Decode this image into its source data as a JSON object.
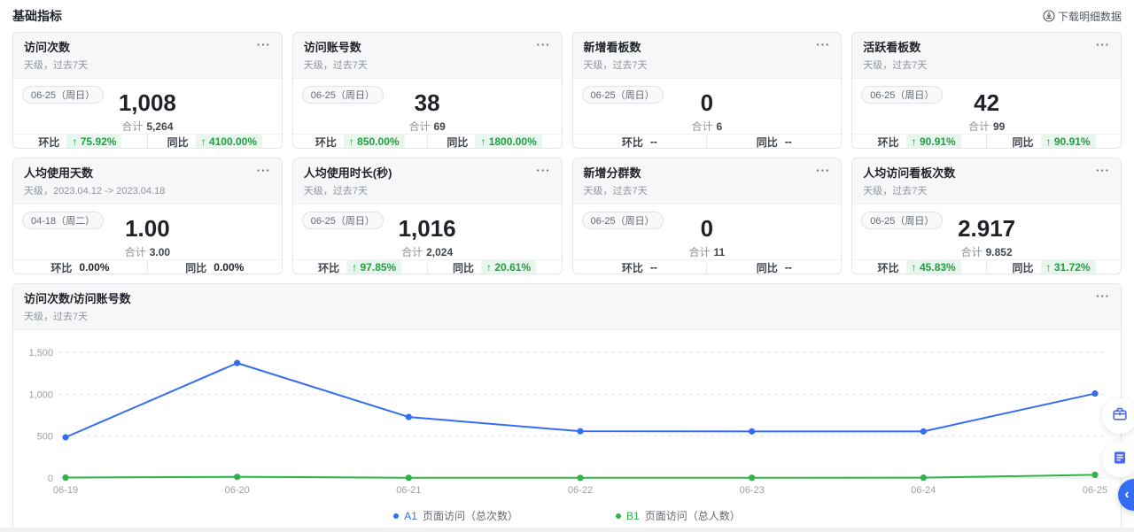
{
  "page": {
    "title": "基础指标",
    "download_label": "下载明细数据",
    "more_label": "···"
  },
  "cards": [
    {
      "title": "访问次数",
      "subtitle": "天级，过去7天",
      "date_badge": "06-25（周日）",
      "value": "1,008",
      "total_label": "合计",
      "total": "5,264",
      "mom_label": "环比",
      "mom": "↑ 75.92%",
      "mom_style": "up",
      "yoy_label": "同比",
      "yoy": "↑ 4100.00%",
      "yoy_style": "up"
    },
    {
      "title": "访问账号数",
      "subtitle": "天级，过去7天",
      "date_badge": "06-25（周日）",
      "value": "38",
      "total_label": "合计",
      "total": "69",
      "mom_label": "环比",
      "mom": "↑ 850.00%",
      "mom_style": "up",
      "yoy_label": "同比",
      "yoy": "↑ 1800.00%",
      "yoy_style": "up"
    },
    {
      "title": "新增看板数",
      "subtitle": "天级，过去7天",
      "date_badge": "06-25（周日）",
      "value": "0",
      "total_label": "合计",
      "total": "6",
      "mom_label": "环比",
      "mom": "--",
      "mom_style": "flat",
      "yoy_label": "同比",
      "yoy": "--",
      "yoy_style": "flat"
    },
    {
      "title": "活跃看板数",
      "subtitle": "天级，过去7天",
      "date_badge": "06-25（周日）",
      "value": "42",
      "total_label": "合计",
      "total": "99",
      "mom_label": "环比",
      "mom": "↑ 90.91%",
      "mom_style": "up",
      "yoy_label": "同比",
      "yoy": "↑ 90.91%",
      "yoy_style": "up"
    },
    {
      "title": "人均使用天数",
      "subtitle": "天级，2023.04.12 -> 2023.04.18",
      "date_badge": "04-18（周二）",
      "value": "1.00",
      "total_label": "合计",
      "total": "3.00",
      "mom_label": "环比",
      "mom": "0.00%",
      "mom_style": "flat",
      "yoy_label": "同比",
      "yoy": "0.00%",
      "yoy_style": "flat"
    },
    {
      "title": "人均使用时长(秒)",
      "subtitle": "天级，过去7天",
      "date_badge": "06-25（周日）",
      "value": "1,016",
      "total_label": "合计",
      "total": "2,024",
      "mom_label": "环比",
      "mom": "↑ 97.85%",
      "mom_style": "up",
      "yoy_label": "同比",
      "yoy": "↑ 20.61%",
      "yoy_style": "up"
    },
    {
      "title": "新增分群数",
      "subtitle": "天级，过去7天",
      "date_badge": "06-25（周日）",
      "value": "0",
      "total_label": "合计",
      "total": "11",
      "mom_label": "环比",
      "mom": "--",
      "mom_style": "flat",
      "yoy_label": "同比",
      "yoy": "--",
      "yoy_style": "flat"
    },
    {
      "title": "人均访问看板次数",
      "subtitle": "天级，过去7天",
      "date_badge": "06-25（周日）",
      "value": "2.917",
      "total_label": "合计",
      "total": "9.852",
      "mom_label": "环比",
      "mom": "↑ 45.83%",
      "mom_style": "up",
      "yoy_label": "同比",
      "yoy": "↑ 31.72%",
      "yoy_style": "up"
    }
  ],
  "chart_card": {
    "title": "访问次数/访问账号数",
    "subtitle": "天级，过去7天"
  },
  "chart_data": {
    "type": "line",
    "title": "访问次数/访问账号数",
    "x": [
      "06-19",
      "06-20",
      "06-21",
      "06-22",
      "06-23",
      "06-24",
      "06-25"
    ],
    "series": [
      {
        "name": "A1 页面访问（总次数）",
        "color": "#336df4",
        "values": [
          486,
          1372,
          728,
          558,
          556,
          556,
          1008
        ]
      },
      {
        "name": "B1 页面访问（总人数）",
        "color": "#2fb24a",
        "values": [
          5,
          14,
          3,
          2,
          3,
          4,
          38
        ]
      }
    ],
    "ylim": [
      0,
      1500
    ],
    "yticks": [
      0,
      500,
      1000,
      1500
    ],
    "ytick_labels": [
      "0",
      "500",
      "1,000",
      "1,500"
    ],
    "grid": true,
    "legend_position": "bottom"
  },
  "legend": [
    {
      "key": "A1",
      "label": "页面访问（总次数）",
      "color": "#336df4"
    },
    {
      "key": "B1",
      "label": "页面访问（总人数）",
      "color": "#2fb24a"
    }
  ],
  "floating_buttons": {
    "toolbox": "工具箱",
    "docs": "文档",
    "help": "‹"
  },
  "colors": {
    "accent_blue": "#336df4",
    "green": "#2fb24a",
    "badge_green_text": "#259b43",
    "badge_green_bg": "#e8f7ed"
  }
}
